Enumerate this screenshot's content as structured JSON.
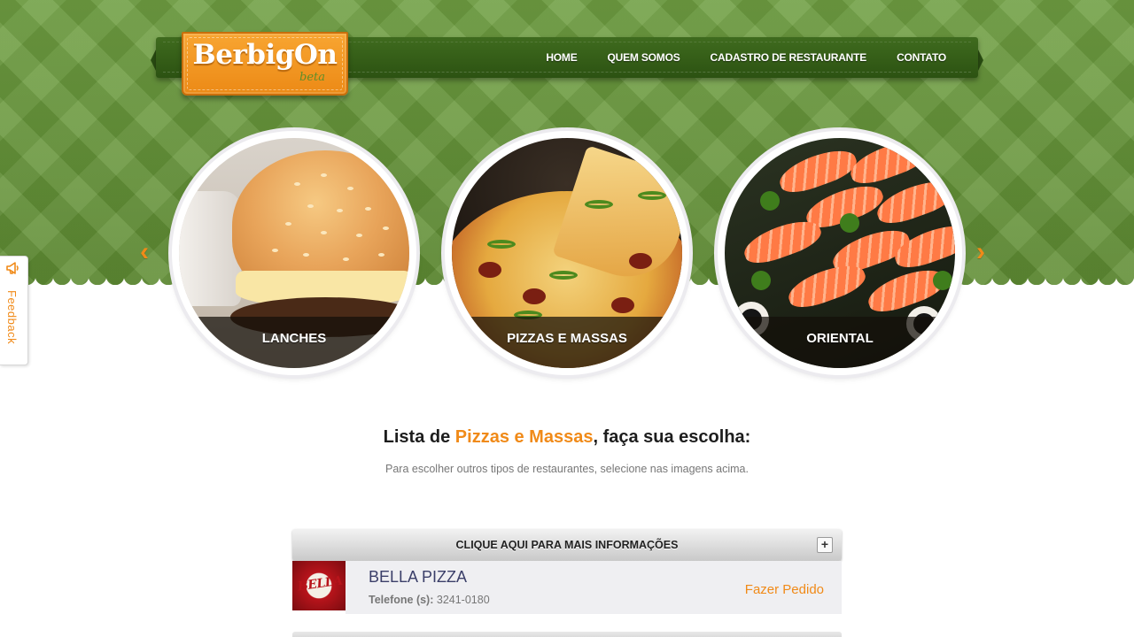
{
  "brand": {
    "name": "BerbigOn",
    "tag": "beta"
  },
  "nav": {
    "items": [
      {
        "label": "HOME"
      },
      {
        "label": "QUEM SOMOS"
      },
      {
        "label": "CADASTRO DE RESTAURANTE"
      },
      {
        "label": "CONTATO"
      }
    ]
  },
  "carousel": {
    "prev_icon": "‹",
    "next_icon": "›",
    "categories": [
      {
        "label": "LANCHES",
        "image": "burger"
      },
      {
        "label": "PIZZAS E MASSAS",
        "image": "pizza"
      },
      {
        "label": "ORIENTAL",
        "image": "sushi"
      }
    ]
  },
  "feedback": {
    "label": "Feedback",
    "icon": "megaphone-icon"
  },
  "heading": {
    "prefix": "Lista de ",
    "highlight": "Pizzas e Massas",
    "suffix": ", faça sua escolha:",
    "subtitle": "Para escolher outros tipos de restaurantes, selecione nas imagens acima."
  },
  "list": {
    "info_bar_label": "CLIQUE AQUI PARA MAIS INFORMAÇÕES",
    "expand_symbol": "+",
    "restaurants": [
      {
        "logo_text": "BELLA",
        "name": "BELLA PIZZA",
        "phone_label": "Telefone (s):",
        "phone": "3241-0180",
        "order_label": "Fazer Pedido"
      }
    ]
  },
  "colors": {
    "accent": "#f08a18",
    "hero_green": "#6b9a3d",
    "nav_green": "#2c5212",
    "restaurant_name": "#3b3f69"
  }
}
